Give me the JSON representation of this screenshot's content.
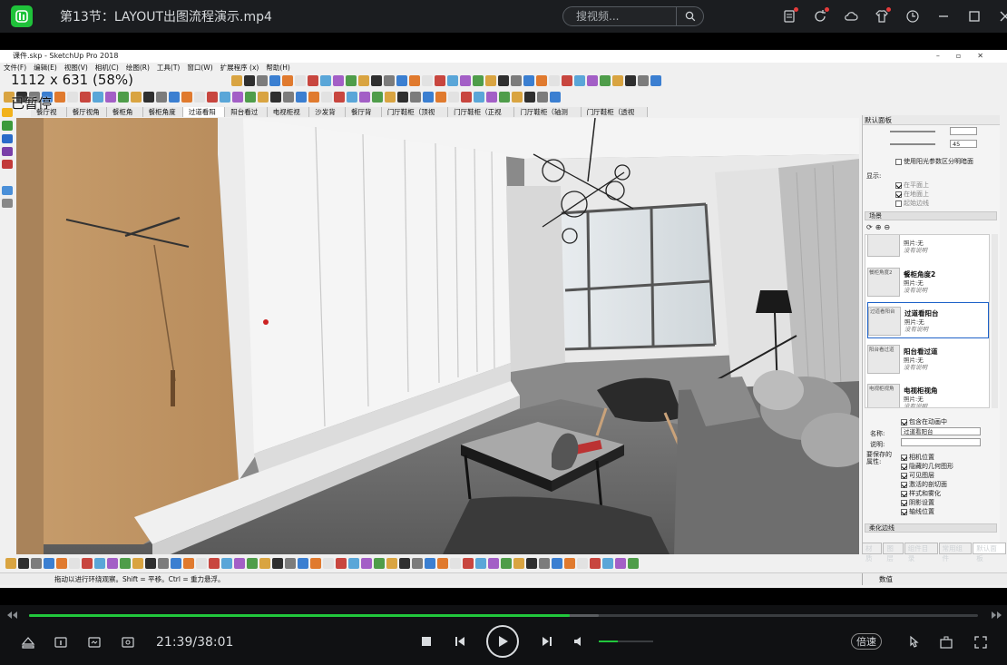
{
  "player": {
    "logo_text": "i",
    "window_title": "第13节：LAYOUT出图流程演示.mp4",
    "search_placeholder": "搜视频...",
    "current_time": "21:39",
    "total_time": "38:01",
    "time_display": "21:39/38:01",
    "speed_label": "倍速",
    "progress_fraction": 0.5695,
    "buffer_fraction": 0.6,
    "volume_fraction": 0.35,
    "accent_color": "#21c73c"
  },
  "overlay": {
    "size_info": "1112 x 631 (58%)",
    "paused_text": "已暂停"
  },
  "sketchup": {
    "title": "课件.skp - SketchUp Pro 2018",
    "menu": [
      "文件(F)",
      "编辑(E)",
      "视图(V)",
      "相机(C)",
      "绘图(R)",
      "工具(T)",
      "窗口(W)",
      "扩展程序 (x)",
      "帮助(H)"
    ],
    "scene_tabs": [
      "餐厅视角",
      "餐厅视角2",
      "餐柜角度",
      "餐柜角度2",
      "过道看阳台",
      "阳台看过道",
      "电视柜视角",
      "沙发背景",
      "餐厅背景",
      "门厅鞋柜（顶视图）",
      "门厅鞋柜（正视图）",
      "门厅鞋柜（轴测图）",
      "门厅鞋柜（透视图）"
    ],
    "active_scene_tab": 4,
    "status_text": "拖动以进行环绕观察。Shift = 平移。Ctrl = 重力悬浮。",
    "measure_label": "数值",
    "tray": {
      "title": "默认面板",
      "slider2_value": "45",
      "checkbox_light": "使用阳光参数区分明暗面",
      "display_label": "显示:",
      "display_opts": [
        "在平面上",
        "在地面上",
        "起始边线"
      ],
      "scenes_section": "场景",
      "scenes": [
        {
          "thumb": "",
          "name": "",
          "sub": "照片:无",
          "sub2": "没有说明"
        },
        {
          "thumb": "餐柜角度2",
          "name": "餐柜角度2",
          "sub": "照片:无",
          "sub2": "没有说明"
        },
        {
          "thumb": "过道看阳台",
          "name": "过道看阳台",
          "sub": "照片:无",
          "sub2": "没有说明"
        },
        {
          "thumb": "阳台看过道",
          "name": "阳台看过道",
          "sub": "照片:无",
          "sub2": "没有说明"
        },
        {
          "thumb": "电视柜视角",
          "name": "电视柜视角",
          "sub": "照片:无",
          "sub2": "没有说明"
        }
      ],
      "selected_scene": 2,
      "include_anim": "包含在动画中",
      "name_label": "名称:",
      "name_value": "过道看阳台",
      "desc_label": "说明:",
      "props_label": "要保存的属性:",
      "props": [
        "相机位置",
        "隐藏的几何图形",
        "可见图层",
        "激活的剖切面",
        "样式和雾化",
        "阴影设置",
        "轴线位置"
      ],
      "soften_section": "柔化边线",
      "bottom_tabs": [
        "材质",
        "图层",
        "组件目录",
        "常用组件",
        "默认面板"
      ]
    }
  }
}
